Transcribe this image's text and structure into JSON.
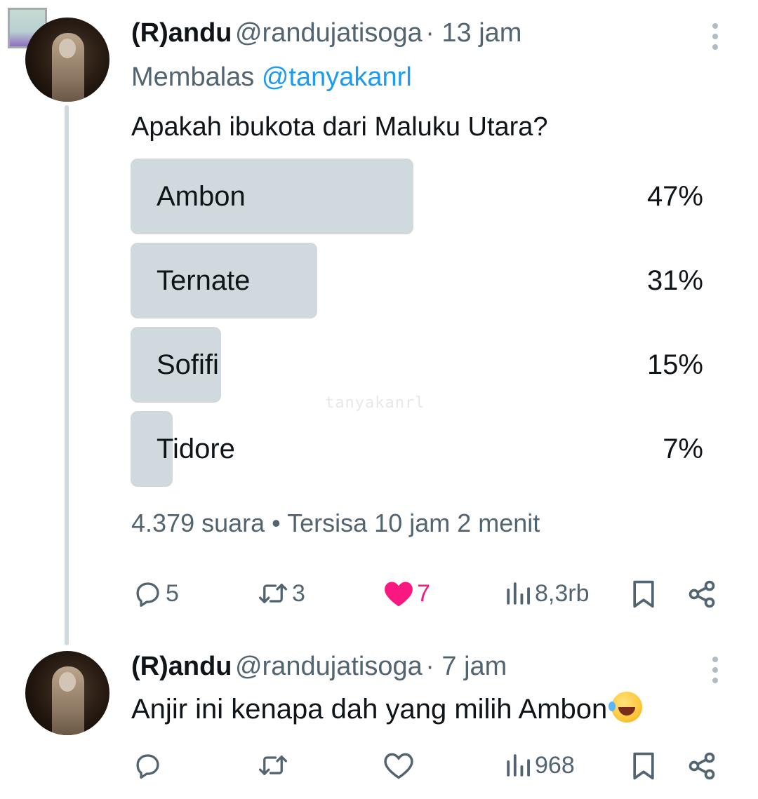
{
  "tweet": {
    "author_name": "(R)andu",
    "handle": "@randujatisoga",
    "time": "· 13 jam",
    "reply_prefix": "Membalas",
    "reply_to": "@tanyakanrl",
    "text": "Apakah ibukota dari Maluku Utara?",
    "poll": {
      "options": [
        {
          "label": "Ambon",
          "percent_text": "47%",
          "percent": 47
        },
        {
          "label": "Ternate",
          "percent_text": "31%",
          "percent": 31
        },
        {
          "label": "Sofifi",
          "percent_text": "15%",
          "percent": 15
        },
        {
          "label": "Tidore",
          "percent_text": "7%",
          "percent": 7
        }
      ],
      "votes": "4.379 suara",
      "separator": "•",
      "remaining": "Tersisa 10 jam 2 menit"
    },
    "watermark": "tanyakanrl",
    "actions": {
      "replies": "5",
      "retweets": "3",
      "likes": "7",
      "views": "8,3rb"
    }
  },
  "reply": {
    "author_name": "(R)andu",
    "handle": "@randujatisoga",
    "time": "· 7 jam",
    "text": "Anjir ini kenapa dah yang milih Ambon",
    "emoji": "rolling-on-floor-laughing",
    "actions": {
      "views": "968"
    }
  },
  "colors": {
    "text": "#0f1419",
    "secondary": "#536471",
    "link": "#1d9bf0",
    "poll_bar": "#cfd9de",
    "like": "#f91880"
  }
}
